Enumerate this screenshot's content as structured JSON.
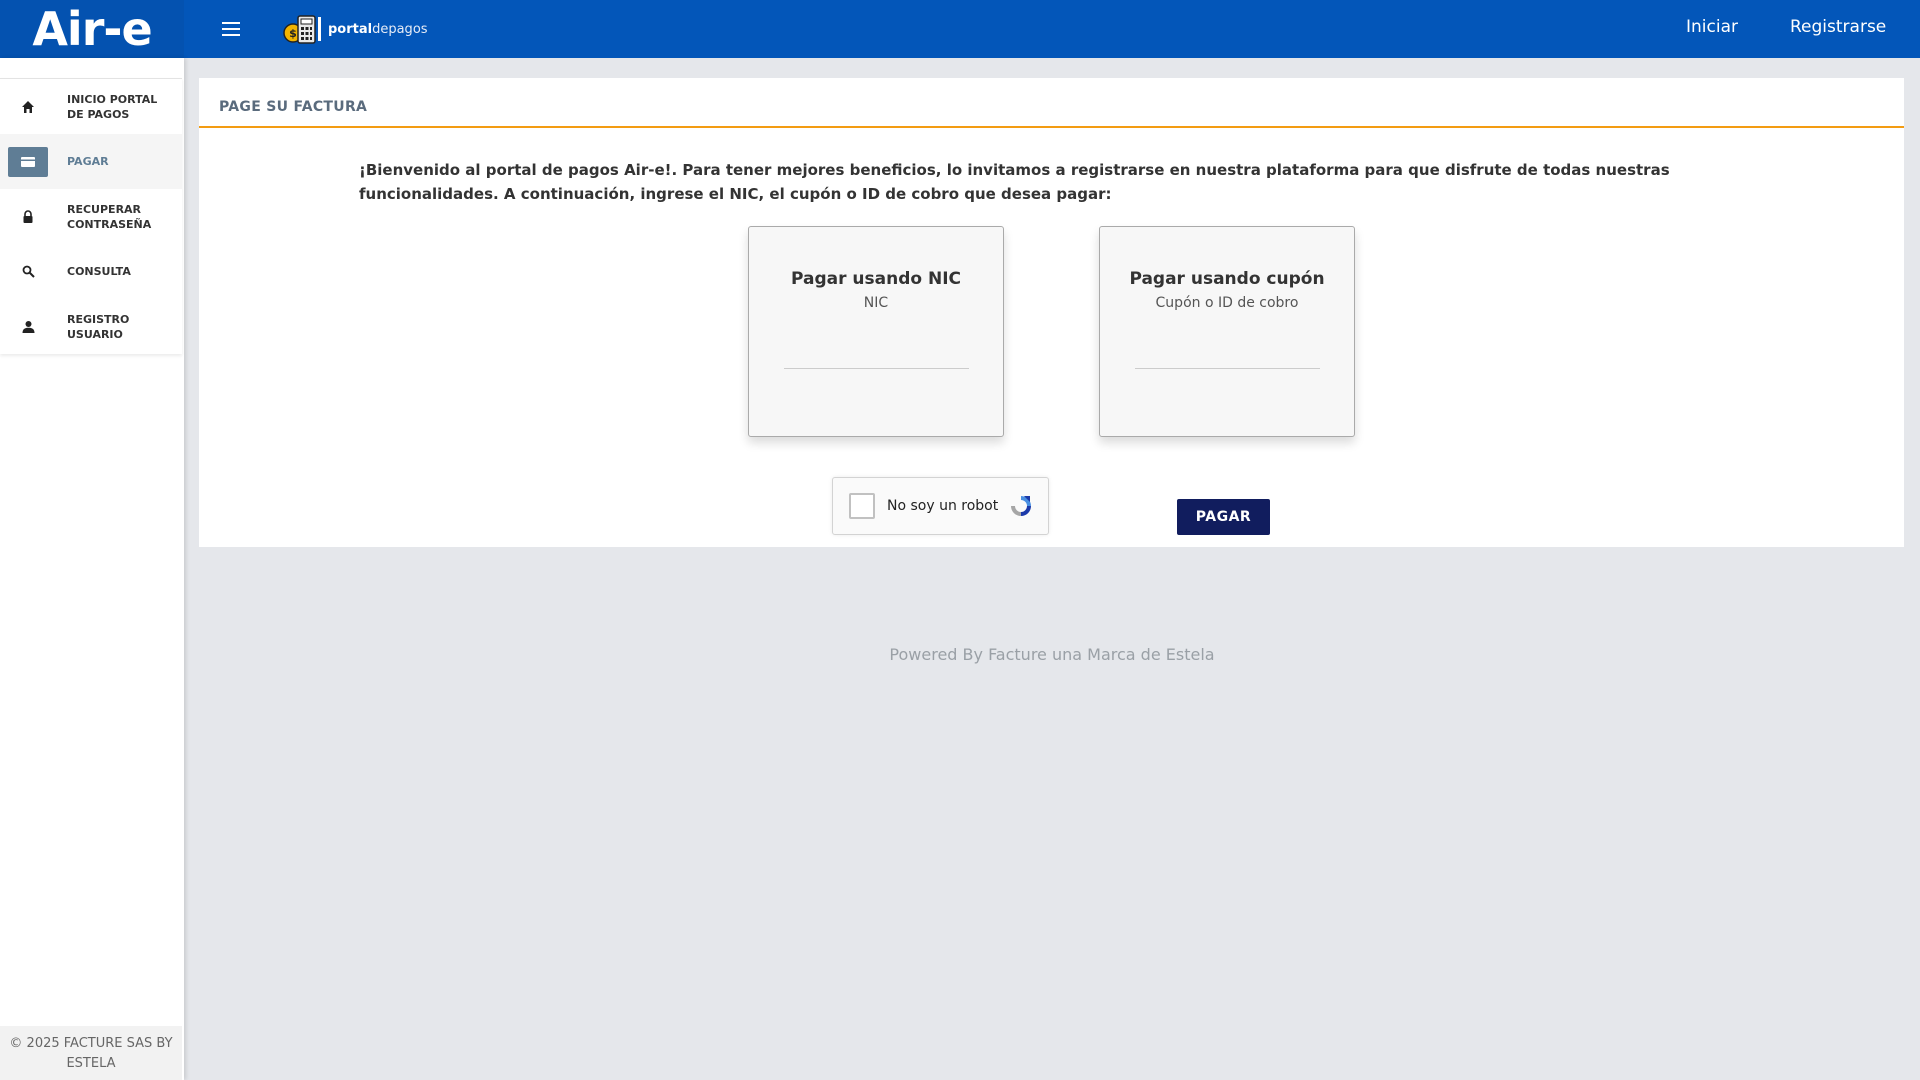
{
  "header": {
    "brand": "Air-e",
    "portal_logo": {
      "bold": "portal",
      "light": "depagos"
    },
    "nav": {
      "iniciar": "Iniciar",
      "registrarse": "Registrarse"
    },
    "colors": {
      "bar": "#0356b9",
      "brand_bg": "#0452b0"
    }
  },
  "sidebar": {
    "items": [
      {
        "label": "INICIO PORTAL DE PAGOS",
        "icon": "home-icon",
        "active": false
      },
      {
        "label": "PAGAR",
        "icon": "credit-card-icon",
        "active": true
      },
      {
        "label": "RECUPERAR CONTRASEÑA",
        "icon": "lock-icon",
        "active": false
      },
      {
        "label": "CONSULTA",
        "icon": "search-icon",
        "active": false
      },
      {
        "label": "REGISTRO USUARIO",
        "icon": "user-icon",
        "active": false
      }
    ],
    "footer": "© 2025 FACTURE SAS BY ESTELA"
  },
  "main": {
    "title": "PAGE SU FACTURA",
    "welcome": "¡Bienvenido al portal de pagos Air-e!. Para tener mejores beneficios, lo invitamos a registrarse en nuestra plataforma para que disfrute de todas nuestras funcionalidades. A continuación, ingrese el NIC, el cupón o ID de cobro que desea pagar:",
    "cards": {
      "nic": {
        "title": "Pagar usando NIC",
        "subtitle": "NIC",
        "value": ""
      },
      "cupon": {
        "title": "Pagar usando cupón",
        "subtitle": "Cupón o ID de cobro",
        "value": ""
      }
    },
    "captcha": {
      "label": "No soy un robot",
      "checked": false
    },
    "pay_button": "PAGAR",
    "accent": "#f39c12",
    "button_color": "#111d5e"
  },
  "footer": {
    "powered": "Powered By Facture una Marca de Estela"
  }
}
